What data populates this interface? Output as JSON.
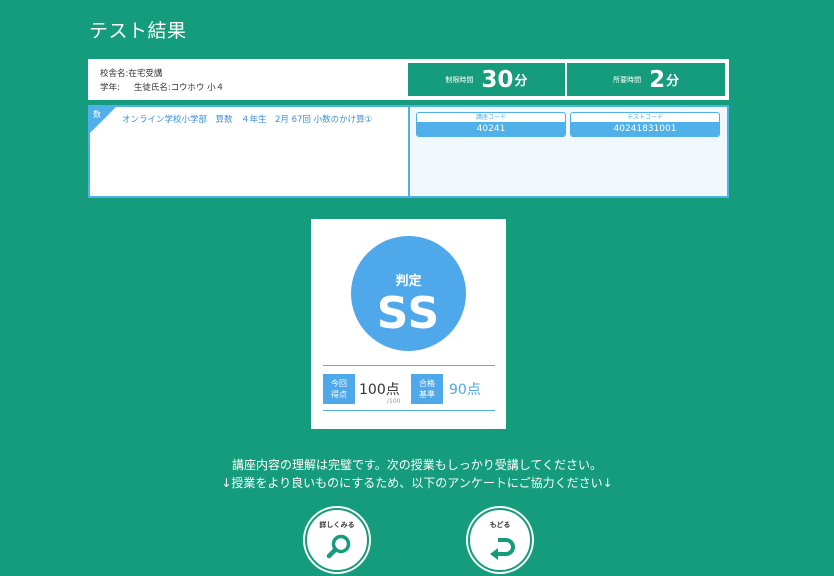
{
  "page": {
    "title": "テスト結果"
  },
  "info": {
    "school_label": "校舎名:在宅受講",
    "grade_label": "学年:",
    "student_label": "生徒氏名:コウホウ 小４",
    "time_limit_label": "制限時間",
    "time_limit_value": "30",
    "time_used_label": "所要時間",
    "time_used_value": "2",
    "minute_unit": "分"
  },
  "course": {
    "subject_char": "数",
    "name": "オンライン学校小学部　算数　４年生　2月 67回 小数のかけ算①",
    "course_code_label": "講座コード",
    "course_code_value": "40241",
    "test_code_label": "テストコード",
    "test_code_value": "40241831001"
  },
  "result": {
    "grade_label": "判定",
    "grade_value": "SS",
    "score_tag": [
      "今回",
      "得点"
    ],
    "score_value": "100点",
    "score_max": "/100",
    "pass_tag": [
      "合格",
      "基準"
    ],
    "pass_value": "90点"
  },
  "messages": {
    "line1": "講座内容の理解は完璧です。次の授業もしっかり受講してください。",
    "line2": "↓授業をより良いものにするため、以下のアンケートにご協力ください↓"
  },
  "buttons": {
    "detail_label": "詳しくみる",
    "back_label": "もどる"
  },
  "colors": {
    "background": "#149c7c",
    "accent": "#4fa8ea"
  },
  "icons": {
    "detail": "magnifier-icon",
    "back": "return-arrow-icon"
  }
}
